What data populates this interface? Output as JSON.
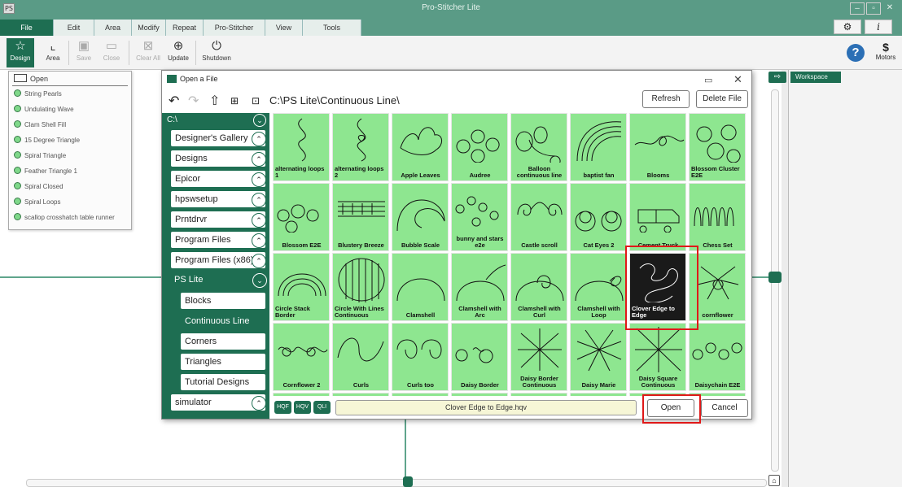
{
  "window": {
    "title": "Pro-Stitcher Lite",
    "app_icon": "PS"
  },
  "menu": {
    "tabs": [
      "File",
      "Edit",
      "Area",
      "Modify",
      "Repeat",
      "Pro-Stitcher",
      "View",
      "Tools"
    ]
  },
  "toolbar": {
    "design": "Design",
    "area": "Area",
    "save": "Save",
    "close": "Close",
    "clear_all": "Clear All",
    "update": "Update",
    "shutdown": "Shutdown",
    "motors": "Motors"
  },
  "workspace": {
    "tab": "Workspace"
  },
  "design_menu": {
    "open": "Open",
    "items": [
      "String Pearls",
      "Undulating Wave",
      "Clam Shell Fill",
      "15 Degree Triangle",
      "Spiral Triangle",
      "Feather Triangle 1",
      "Spiral Closed",
      "Spiral Loops",
      "scallop crosshatch table runner"
    ]
  },
  "dialog": {
    "title": "Open a File",
    "path": "C:\\PS Lite\\Continuous Line\\",
    "refresh": "Refresh",
    "delete_file": "Delete File",
    "open": "Open",
    "cancel": "Cancel",
    "filename": "Clover Edge to Edge.hqv",
    "formats": [
      "HQF",
      "HQV",
      "QLI"
    ]
  },
  "tree": {
    "root": "C:\\",
    "folders": [
      "Designer's Gallery",
      "Designs",
      "Epicor",
      "hpswsetup",
      "Prntdrvr",
      "Program Files",
      "Program Files (x86)",
      "PS Lite"
    ],
    "ps_lite_children": [
      "Blocks",
      "Continuous Line",
      "Corners",
      "Triangles",
      "Tutorial Designs"
    ],
    "after": [
      "simulator"
    ]
  },
  "files": [
    "alternating loops 1",
    "alternating loops 2",
    "Apple Leaves",
    "Audree",
    "Balloon continuous line",
    "baptist fan",
    "Blooms",
    "Blossom Cluster E2E",
    "Blossom E2E",
    "Blustery Breeze",
    "Bubble Scale",
    "bunny and stars e2e",
    "Castle scroll",
    "Cat Eyes 2",
    "Cement Truck",
    "Chess Set",
    "Circle Stack Border",
    "Circle With Lines Continuous",
    "Clamshell",
    "Clamshell with Arc",
    "Clamshell with Curl",
    "Clamshell with Loop",
    "Clover Edge to Edge",
    "cornflower",
    "Cornflower 2",
    "Curls",
    "Curls too",
    "Daisy Border",
    "Daisy Border Continuous",
    "Daisy Marie",
    "Daisy Square Continuous",
    "Daisychain E2E"
  ],
  "selected_file_index": 22,
  "colors": {
    "brand_green": "#1e6e52",
    "thumb_green": "#8ee690",
    "highlight_red": "#e01919"
  }
}
